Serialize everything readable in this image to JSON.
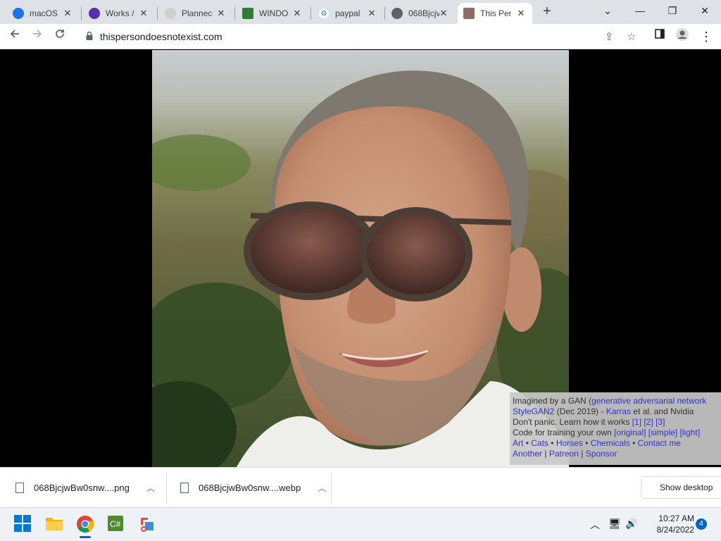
{
  "tabs": [
    {
      "label": "macOS",
      "icon": "finder-icon",
      "color": "#1a73e8"
    },
    {
      "label": "Works /",
      "icon": "works-icon",
      "color": "#5b2dab"
    },
    {
      "label": "Plannec",
      "icon": "gear-icon",
      "color": "#b0b0b0"
    },
    {
      "label": "WINDO",
      "icon": "windows-app-icon",
      "color": "#2e7d32"
    },
    {
      "label": "paypal",
      "icon": "google-icon",
      "color": "#ea4335"
    },
    {
      "label": "068Bjcjv",
      "icon": "globe-icon",
      "color": "#5f6368"
    },
    {
      "label": "This Per",
      "icon": "face-icon",
      "color": "#8d6e63"
    }
  ],
  "address": {
    "url": "thispersondoesnotexist.com"
  },
  "caption": {
    "line1_prefix": "Imagined by a GAN (",
    "line1_link": "generative adversarial network",
    "line2_link1": "StyleGAN2",
    "line2_mid": " (Dec 2019) - ",
    "line2_link2": "Karras",
    "line2_suffix": " et al. and Nvidia",
    "line3_text": "Don't panic. Learn how it works ",
    "line3_links": [
      "[1]",
      "[2]",
      "[3]"
    ],
    "line4_text": "Code for training your own ",
    "line4_links": [
      "[original]",
      "[simple]",
      "[light]"
    ],
    "line5_links": [
      "Art",
      "Cats",
      "Horses",
      "Chemicals",
      "Contact me"
    ],
    "line5_sep": "•",
    "line6_links": [
      "Another",
      "Patreon",
      "Sponsor"
    ],
    "line6_sep": "|"
  },
  "downloads": [
    {
      "name": "068BjcjwBw0snw....png"
    },
    {
      "name": "068BjcjwBw0snw....webp"
    }
  ],
  "show_desktop": "Show desktop",
  "taskbar": {
    "time": "10:27 AM",
    "date": "8/24/2022",
    "notifications": "4"
  }
}
